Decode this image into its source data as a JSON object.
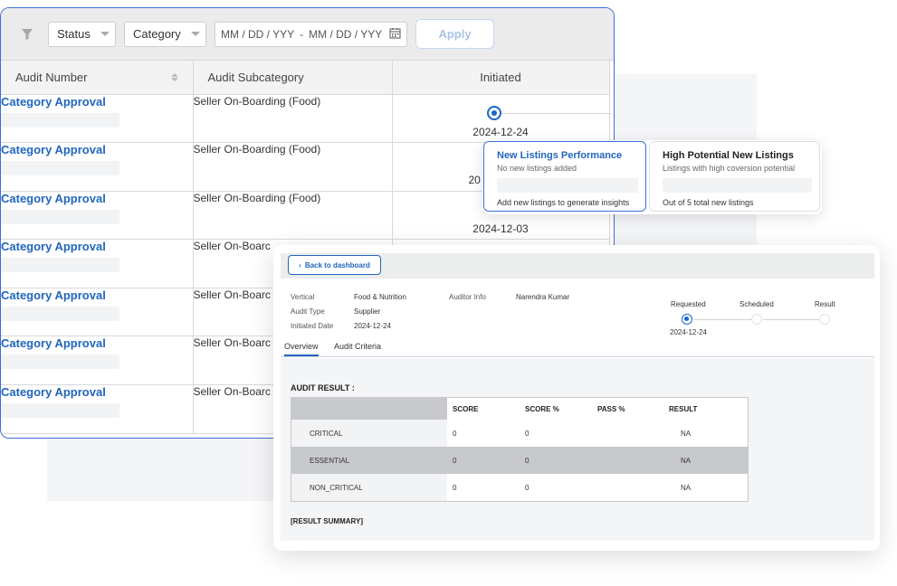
{
  "filters": {
    "status_label": "Status",
    "category_label": "Category",
    "date_from_placeholder": "MM / DD / YYY",
    "date_separator": "-",
    "date_to_placeholder": "MM / DD / YYY",
    "apply_label": "Apply"
  },
  "table": {
    "headers": [
      "Audit Number",
      "Audit Subcategory",
      "Initiated"
    ],
    "rows": [
      {
        "audit": "Category Approval",
        "subcategory": "Seller On-Boarding (Food)",
        "date": "2024-12-24"
      },
      {
        "audit": "Category Approval",
        "subcategory": "Seller On-Boarding (Food)",
        "date": "20"
      },
      {
        "audit": "Category Approval",
        "subcategory": "Seller On-Boarding (Food)",
        "date": "2024-12-03"
      },
      {
        "audit": "Category Approval",
        "subcategory": "Seller On-Boarc",
        "date": ""
      },
      {
        "audit": "Category Approval",
        "subcategory": "Seller On-Boarc",
        "date": ""
      },
      {
        "audit": "Category Approval",
        "subcategory": "Seller On-Boarc",
        "date": ""
      },
      {
        "audit": "Category Approval",
        "subcategory": "Seller On-Boarc",
        "date": ""
      }
    ]
  },
  "insights": [
    {
      "title": "New Listings Performance",
      "subtitle": "No new listings added",
      "footer": "Add new listings to generate insights"
    },
    {
      "title": "High Potential New Listings",
      "subtitle": "Listings with high coversion potential",
      "footer": "Out of 5 total new listings"
    }
  ],
  "detail": {
    "back_label": "Back to dashboard",
    "vertical_label": "Vertical",
    "vertical_value": "Food & Nutrition",
    "auditor_label": "Auditor Info",
    "auditor_value": "Narendra Kumar",
    "audit_type_label": "Audit Type",
    "audit_type_value": "Supplier",
    "initiated_label": "Initiated Date",
    "initiated_value": "2024-12-24",
    "steps": [
      "Requested",
      "Scheduled",
      "Result"
    ],
    "step_date": "2024-12-24",
    "tabs": [
      "Overview",
      "Audit Criteria"
    ],
    "result_title": "AUDIT RESULT :",
    "result_headers": [
      "",
      "SCORE",
      "SCORE %",
      "PASS %",
      "RESULT"
    ],
    "result_rows": [
      {
        "name": "CRITICAL",
        "score": "0",
        "score_pct": "0",
        "pass_pct": "",
        "result": "NA"
      },
      {
        "name": "ESSENTIAL",
        "score": "0",
        "score_pct": "0",
        "pass_pct": "",
        "result": "NA"
      },
      {
        "name": "NON_CRITICAL",
        "score": "0",
        "score_pct": "0",
        "pass_pct": "",
        "result": "NA"
      }
    ],
    "summary_label": "[RESULT SUMMARY]"
  },
  "colors": {
    "accent": "#2266bb",
    "border_accent": "#3d6fd8"
  }
}
